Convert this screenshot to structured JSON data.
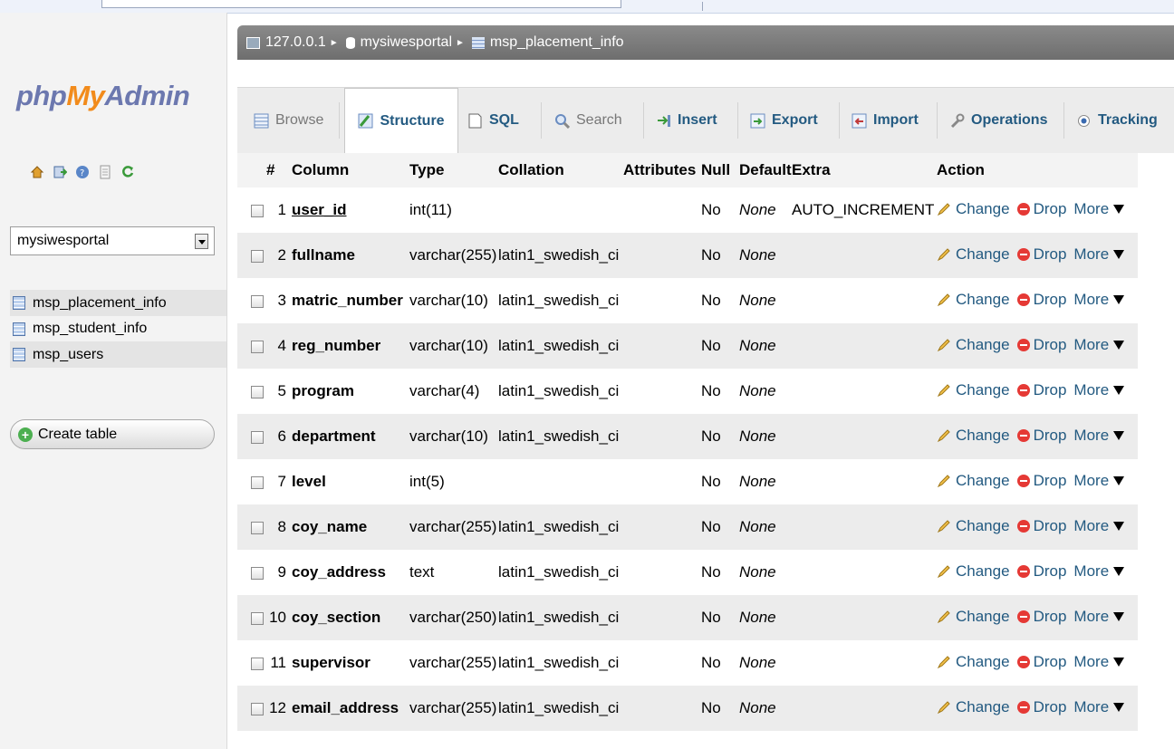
{
  "app": {
    "logo": {
      "php": "php",
      "my": "My",
      "admin": "Admin"
    }
  },
  "nav": {
    "icons": [
      "home-icon",
      "exit-icon",
      "help-icon",
      "docs-icon",
      "reload-icon"
    ],
    "db_select": "mysiwesportal",
    "tables": [
      "msp_placement_info",
      "msp_student_info",
      "msp_users"
    ],
    "create_table": "Create table"
  },
  "breadcrumb": {
    "server": "127.0.0.1",
    "database": "mysiwesportal",
    "table": "msp_placement_info"
  },
  "tabs": [
    {
      "label": "Browse",
      "icon": "browse-icon"
    },
    {
      "label": "Structure",
      "icon": "structure-icon"
    },
    {
      "label": "SQL",
      "icon": "sql-icon"
    },
    {
      "label": "Search",
      "icon": "search-icon"
    },
    {
      "label": "Insert",
      "icon": "insert-icon"
    },
    {
      "label": "Export",
      "icon": "export-icon"
    },
    {
      "label": "Import",
      "icon": "import-icon"
    },
    {
      "label": "Operations",
      "icon": "operations-icon"
    },
    {
      "label": "Tracking",
      "icon": "tracking-icon"
    }
  ],
  "table": {
    "headers": {
      "num": "#",
      "column": "Column",
      "type": "Type",
      "collation": "Collation",
      "attributes": "Attributes",
      "null": "Null",
      "default": "Default",
      "extra": "Extra",
      "action": "Action"
    },
    "actions": {
      "change": "Change",
      "drop": "Drop",
      "more": "More"
    },
    "rows": [
      {
        "num": "1",
        "column": "user_id",
        "type": "int(11)",
        "collation": "",
        "attributes": "",
        "null": "No",
        "default": "None",
        "extra": "AUTO_INCREMENT"
      },
      {
        "num": "2",
        "column": "fullname",
        "type": "varchar(255)",
        "collation": "latin1_swedish_ci",
        "attributes": "",
        "null": "No",
        "default": "None",
        "extra": ""
      },
      {
        "num": "3",
        "column": "matric_number",
        "type": "varchar(10)",
        "collation": "latin1_swedish_ci",
        "attributes": "",
        "null": "No",
        "default": "None",
        "extra": ""
      },
      {
        "num": "4",
        "column": "reg_number",
        "type": "varchar(10)",
        "collation": "latin1_swedish_ci",
        "attributes": "",
        "null": "No",
        "default": "None",
        "extra": ""
      },
      {
        "num": "5",
        "column": "program",
        "type": "varchar(4)",
        "collation": "latin1_swedish_ci",
        "attributes": "",
        "null": "No",
        "default": "None",
        "extra": ""
      },
      {
        "num": "6",
        "column": "department",
        "type": "varchar(10)",
        "collation": "latin1_swedish_ci",
        "attributes": "",
        "null": "No",
        "default": "None",
        "extra": ""
      },
      {
        "num": "7",
        "column": "level",
        "type": "int(5)",
        "collation": "",
        "attributes": "",
        "null": "No",
        "default": "None",
        "extra": ""
      },
      {
        "num": "8",
        "column": "coy_name",
        "type": "varchar(255)",
        "collation": "latin1_swedish_ci",
        "attributes": "",
        "null": "No",
        "default": "None",
        "extra": ""
      },
      {
        "num": "9",
        "column": "coy_address",
        "type": "text",
        "collation": "latin1_swedish_ci",
        "attributes": "",
        "null": "No",
        "default": "None",
        "extra": ""
      },
      {
        "num": "10",
        "column": "coy_section",
        "type": "varchar(250)",
        "collation": "latin1_swedish_ci",
        "attributes": "",
        "null": "No",
        "default": "None",
        "extra": ""
      },
      {
        "num": "11",
        "column": "supervisor",
        "type": "varchar(255)",
        "collation": "latin1_swedish_ci",
        "attributes": "",
        "null": "No",
        "default": "None",
        "extra": ""
      },
      {
        "num": "12",
        "column": "email_address",
        "type": "varchar(255)",
        "collation": "latin1_swedish_ci",
        "attributes": "",
        "null": "No",
        "default": "None",
        "extra": ""
      }
    ]
  }
}
